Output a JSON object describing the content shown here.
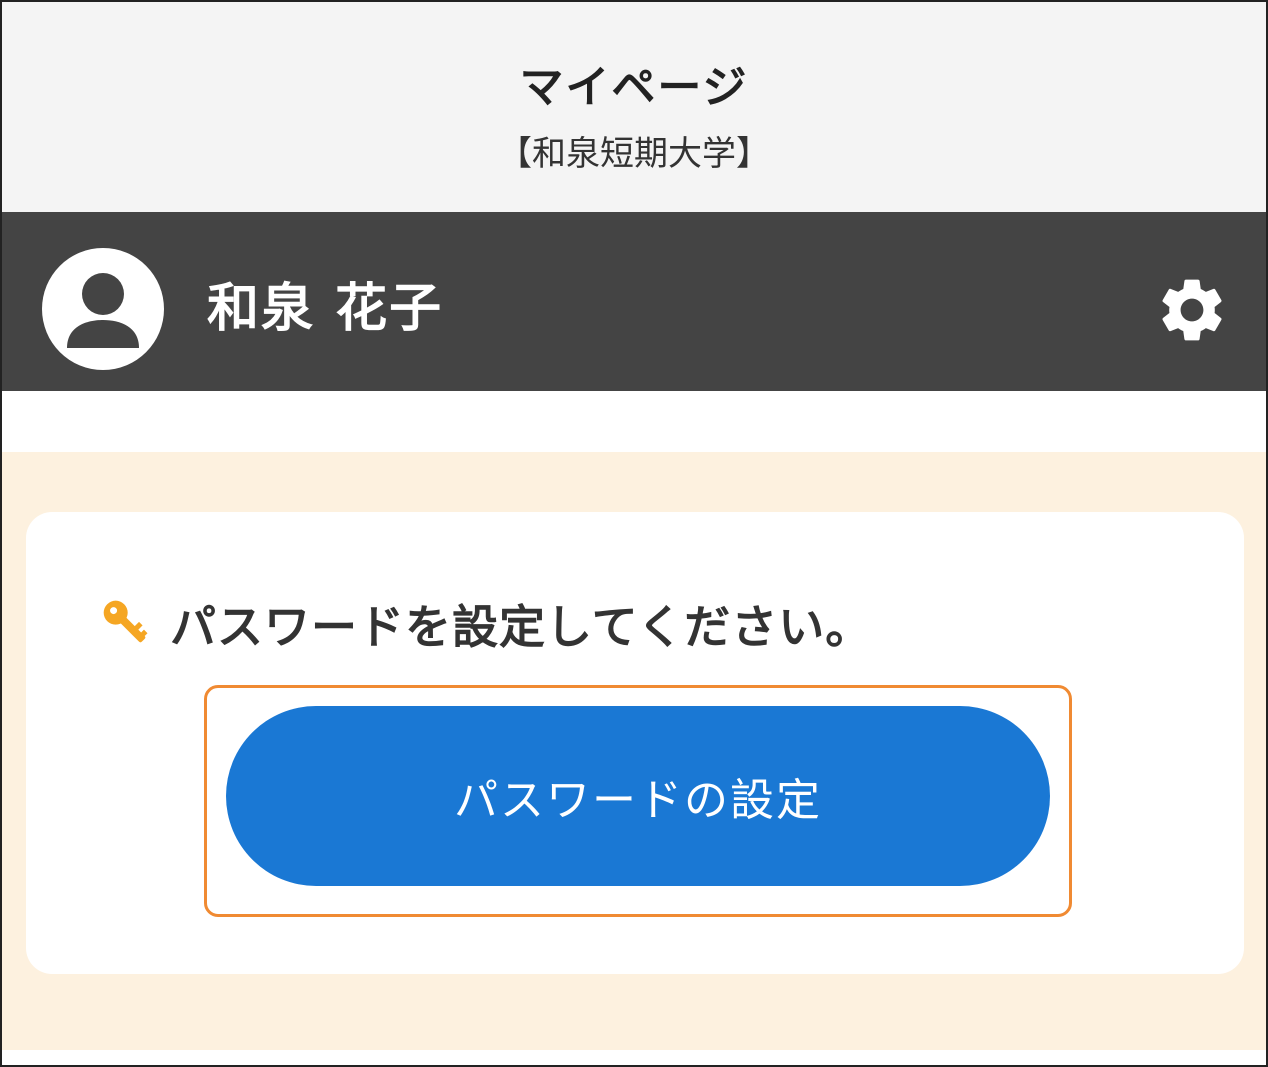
{
  "header": {
    "title": "マイページ",
    "subtitle": "【和泉短期大学】"
  },
  "user": {
    "name": "和泉 花子",
    "avatar_icon": "user-avatar-icon",
    "settings_icon": "gear-icon"
  },
  "password_card": {
    "icon": "key-icon",
    "message": "パスワードを設定してください。",
    "button_label": "パスワードの設定"
  },
  "colors": {
    "header_bg": "#f4f4f4",
    "userbar_bg": "#444444",
    "content_bg": "#fdf1df",
    "button_bg": "#1a78d4",
    "highlight_border": "#f08a32",
    "key_icon": "#f5a623"
  }
}
